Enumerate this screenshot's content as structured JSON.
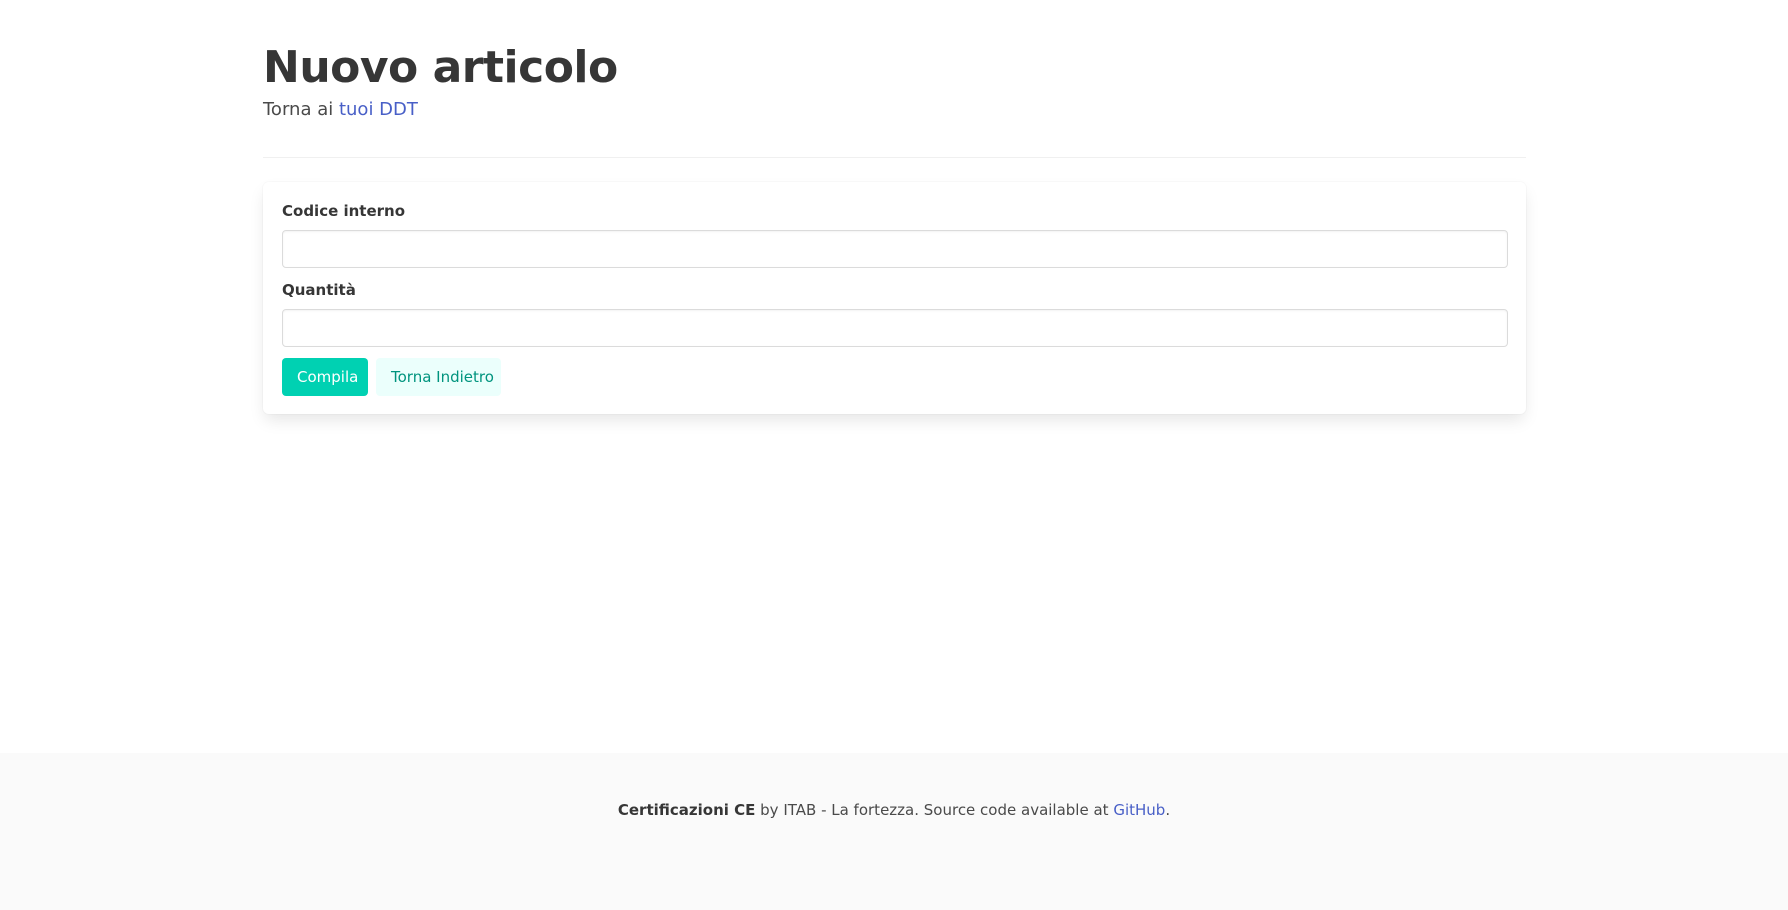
{
  "header": {
    "title": "Nuovo articolo",
    "subtitle_prefix": "Torna ai",
    "subtitle_link": "tuoi DDT"
  },
  "form": {
    "fields": [
      {
        "label": "Codice interno",
        "value": "",
        "placeholder": ""
      },
      {
        "label": "Quantità",
        "value": "",
        "placeholder": ""
      }
    ],
    "submit_label": "Compila",
    "back_label": "Torna Indietro"
  },
  "footer": {
    "brand": "Certificazioni CE",
    "middle_text": "by ITAB - La fortezza. Source code available at",
    "link_text": "GitHub",
    "end_text": "."
  },
  "colors": {
    "primary": "#00d1b2",
    "link": "#485fc7",
    "footer_bg": "#fafafa"
  }
}
